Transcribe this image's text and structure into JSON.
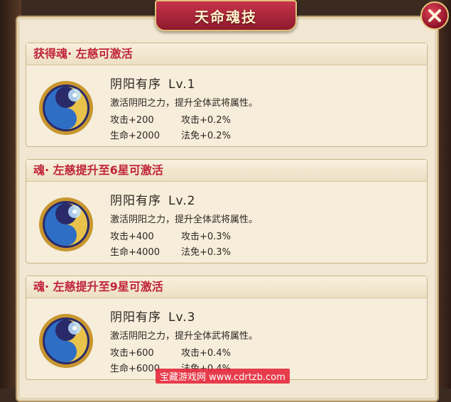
{
  "panel": {
    "title": "天命魂技"
  },
  "cards": [
    {
      "header": "获得魂· 左慈可激活",
      "skill_name": "阴阳有序",
      "level": "Lv.1",
      "description": "激活阴阳之力，提升全体武将属性。",
      "stats": {
        "attack_flat": "攻击+200",
        "attack_pct": "攻击+0.2%",
        "hp_flat": "生命+2000",
        "magic_res_pct": "法免+0.2%"
      }
    },
    {
      "header": "魂· 左慈提升至6星可激活",
      "skill_name": "阴阳有序",
      "level": "Lv.2",
      "description": "激活阴阳之力，提升全体武将属性。",
      "stats": {
        "attack_flat": "攻击+400",
        "attack_pct": "攻击+0.3%",
        "hp_flat": "生命+4000",
        "magic_res_pct": "法免+0.3%"
      }
    },
    {
      "header": "魂· 左慈提升至9星可激活",
      "skill_name": "阴阳有序",
      "level": "Lv.3",
      "description": "激活阴阳之力，提升全体武将属性。",
      "stats": {
        "attack_flat": "攻击+600",
        "attack_pct": "攻击+0.4%",
        "hp_flat": "生命+6000",
        "magic_res_pct": "法免+0.4%"
      }
    }
  ],
  "watermark": "宝藏游戏网 www.cdrtzb.com",
  "icons": {
    "close": "close-icon",
    "skill": "yin-yang-skill-icon"
  },
  "colors": {
    "header_text": "#c0233a",
    "banner": "#a52238",
    "panel_bg": "#f1e7d2"
  }
}
